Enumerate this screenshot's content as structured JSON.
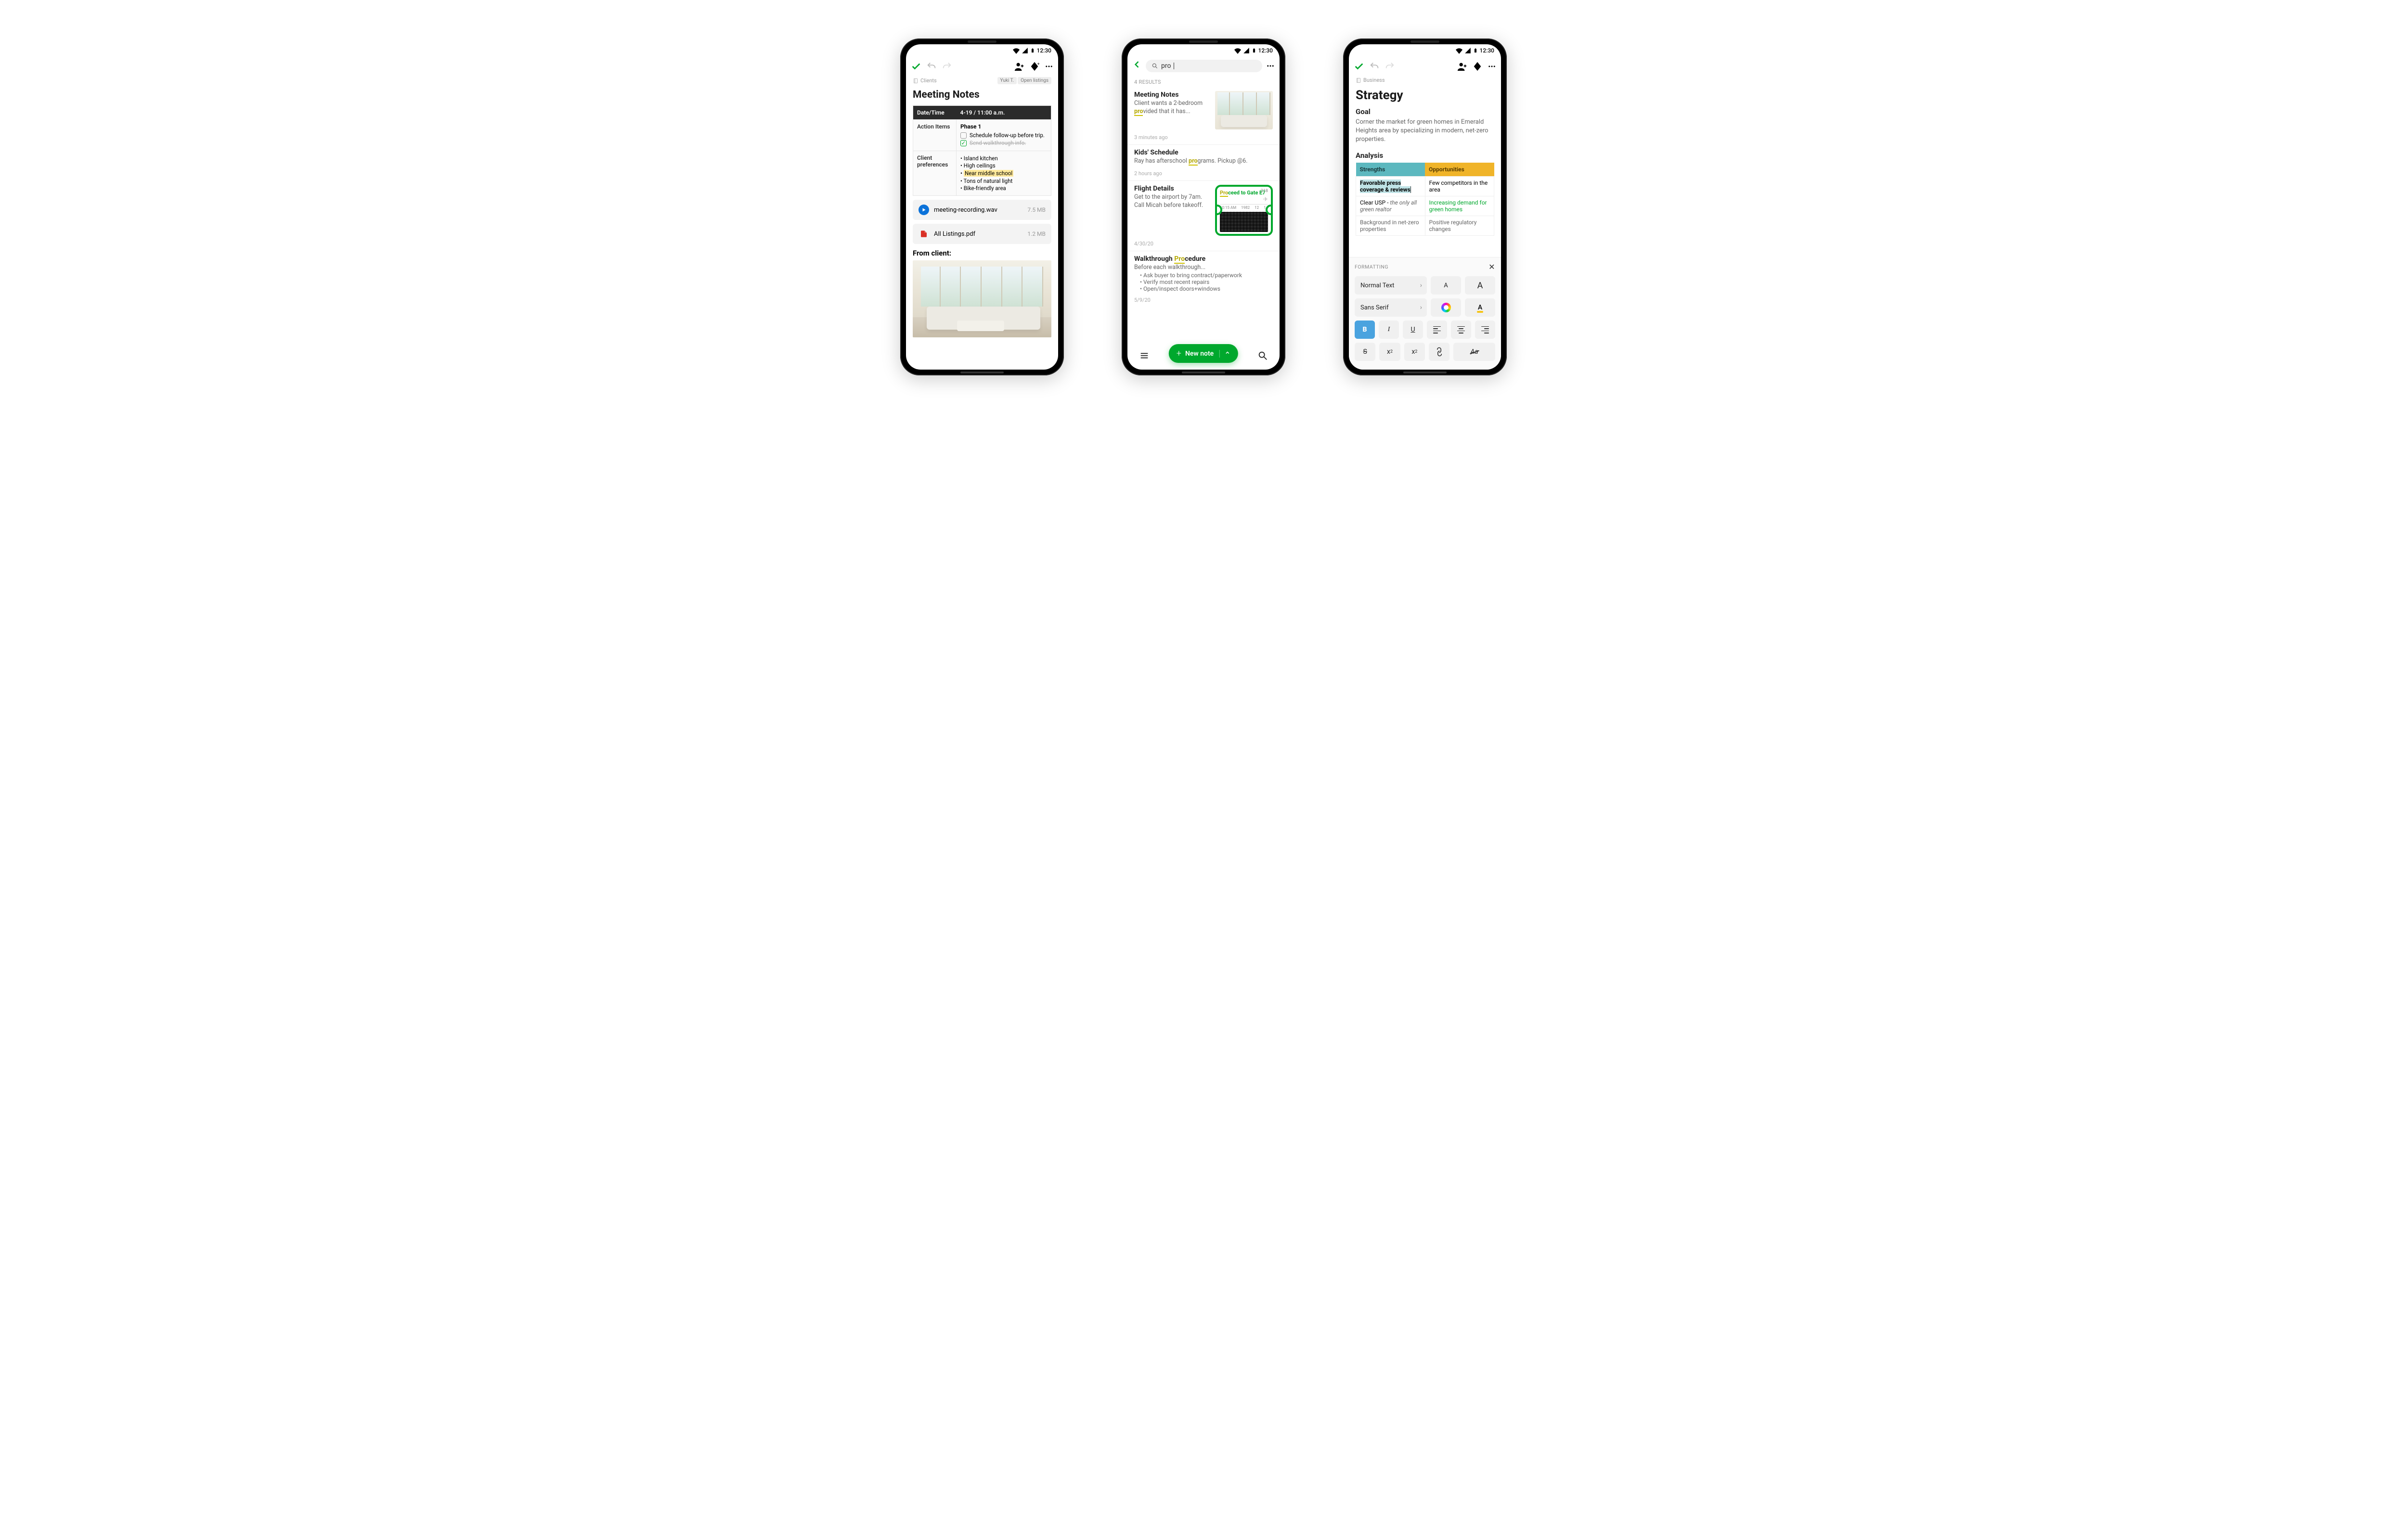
{
  "status": {
    "time": "12:30"
  },
  "screen1": {
    "notebook": "Clients",
    "tags": [
      "Yuki T.",
      "Open listings"
    ],
    "title": "Meeting Notes",
    "table": {
      "h1": "Date/Time",
      "h2": "4-19 / 11:00 a.m.",
      "actionItemsLabel": "Action Items",
      "phase": "Phase 1",
      "check1": "Schedule follow-up before trip.",
      "check2": "Send walkthrough info.",
      "prefsLabel": "Client preferences",
      "prefs": [
        "Island kitchen",
        "High ceilings",
        "Near middle school",
        "Tons of natural light",
        "Bike-friendly area"
      ]
    },
    "att1": {
      "name": "meeting-recording.wav",
      "size": "7.5 MB"
    },
    "att2": {
      "name": "All Listings.pdf",
      "size": "1.2 MB"
    },
    "fromClient": "From client:"
  },
  "screen2": {
    "query": "pro",
    "resultsHeader": "4 RESULTS",
    "r1": {
      "title": "Meeting Notes",
      "snip_pre": "Client wants a 2-bedroom ",
      "snip_hl": "pro",
      "snip_post": "vided that it has...",
      "time": "3 minutes ago"
    },
    "r2": {
      "title": "Kids' Schedule",
      "snip_pre": "Ray has afterschool ",
      "snip_hl": "pro",
      "snip_post": "grams. Pickup @6.",
      "time": "2 hours ago"
    },
    "r3": {
      "title": "Flight Details",
      "snip": "Get to the airport by 7am. Call Micah before takeoff.",
      "ticket_pre": "Pro",
      "ticket_line": "ceed to Gate E7",
      "ticket_seat": "218",
      "ticket_info": [
        "10:15 AM",
        "1982",
        "12",
        "1"
      ],
      "time": "4/30/20"
    },
    "r4": {
      "title_pre": "Walkthrough ",
      "title_hl": "Pro",
      "title_post": "cedure",
      "intro": "Before each walkthrough...",
      "b1": "Ask buyer to bring contract/paperwork",
      "b2": "Verify most recent repairs",
      "b3": "Open/inspect doors+windows",
      "time": "5/9/20"
    },
    "newNote": "New note"
  },
  "screen3": {
    "notebook": "Business",
    "title": "Strategy",
    "goalLabel": "Goal",
    "goalText": "Corner the market for green homes in Emerald Heights area by specializing in modern, net-zero properties.",
    "analysisLabel": "Analysis",
    "strengths": "Strengths",
    "opportunities": "Opportunities",
    "s1": "Favorable press coverage & reviews",
    "o1": "Few competitors in the area",
    "s2_pre": "Clear USP - ",
    "s2_em": "the only all green realtor",
    "o2": "Increasing demand for green homes",
    "s3": "Background in net-zero properties",
    "o3": "Positive regulatory changes",
    "formatting": "FORMATTING",
    "normalText": "Normal Text",
    "sansSerif": "Sans Serif"
  }
}
